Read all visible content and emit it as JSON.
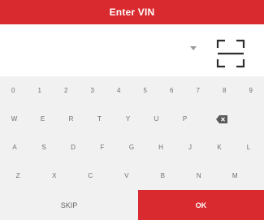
{
  "header": {
    "title": "Enter VIN"
  },
  "input": {
    "value": "",
    "placeholder": ""
  },
  "icons": {
    "dropdown": "caret-down-icon",
    "scan": "scan-frame-icon",
    "backspace": "backspace-icon"
  },
  "keyboard": {
    "row1": [
      "0",
      "1",
      "2",
      "3",
      "4",
      "5",
      "6",
      "7",
      "8",
      "9"
    ],
    "row2": [
      "W",
      "E",
      "R",
      "T",
      "Y",
      "U",
      "P"
    ],
    "row3": [
      "A",
      "S",
      "D",
      "F",
      "G",
      "H",
      "J",
      "K",
      "L"
    ],
    "row4": [
      "Z",
      "X",
      "C",
      "V",
      "B",
      "N",
      "M"
    ]
  },
  "footer": {
    "skip_label": "SKIP",
    "ok_label": "OK"
  },
  "colors": {
    "accent": "#d92b2f",
    "keyboard_bg": "#f1f1f1",
    "key_text": "#707070"
  }
}
